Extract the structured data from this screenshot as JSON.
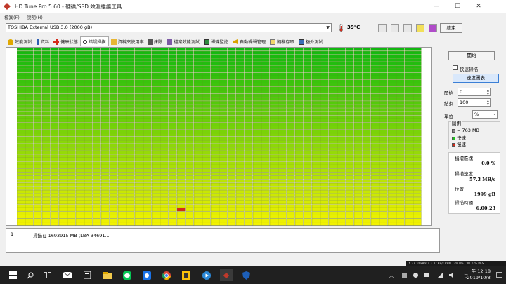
{
  "window": {
    "title": "HD Tune Pro 5.60 - 硬碟/SSD 效測維護工具",
    "controls": {
      "minimize": "—",
      "maximize": "☐",
      "close": "✕"
    }
  },
  "menu": [
    "檔案(F)",
    "說明(H)"
  ],
  "device": {
    "selected": "TOSHIBA External USB 3.0 (2000 gB)",
    "temperature": "39℃",
    "exit_label": "結束"
  },
  "tabs": [
    {
      "label": "效能測試",
      "icon": "benchmark-icon"
    },
    {
      "label": "資料",
      "icon": "info-icon"
    },
    {
      "label": "健康狀態",
      "icon": "health-icon"
    },
    {
      "label": "錯誤掃描",
      "icon": "error-scan-icon",
      "active": true
    },
    {
      "label": "資料夾使用率",
      "icon": "folder-usage-icon"
    },
    {
      "label": "抹除",
      "icon": "erase-icon"
    },
    {
      "label": "檔案效能測試",
      "icon": "file-benchmark-icon"
    },
    {
      "label": "磁碟監控",
      "icon": "disk-monitor-icon"
    },
    {
      "label": "自動噪聲管理",
      "icon": "aam-icon"
    },
    {
      "label": "隨機存取",
      "icon": "random-access-icon"
    },
    {
      "label": "額外測試",
      "icon": "extra-tests-icon"
    }
  ],
  "error_scan": {
    "start_button": "開始",
    "quick_scan_label": "快速掃描",
    "quick_scan_checked": false,
    "speed_map_button": "速度圖表",
    "start_label": "開始",
    "start_value": "0",
    "end_label": "結束",
    "end_value": "100",
    "unit_label": "單位",
    "unit_value": "%",
    "legend_title": "圖例",
    "legend": [
      {
        "label": "= 763 MB",
        "color": "#8a8a8a"
      },
      {
        "label": "快速",
        "color": "#1fbf1f"
      },
      {
        "label": "慢速",
        "color": "#d42a1a"
      }
    ],
    "stats": {
      "damaged_label": "損壞區塊",
      "damaged_value": "0.0 %",
      "speed_label": "掃描速度",
      "speed_value": "57.3 MB/s",
      "position_label": "位置",
      "position_value": "1999 gB",
      "elapsed_label": "掃描時間",
      "elapsed_value": "6:00:23"
    },
    "grid": {
      "cols": 48,
      "rows": 50,
      "highlight_colors": {
        "top": "#00b400",
        "bottom": "#f2f200",
        "slow": "#d42a1a"
      }
    }
  },
  "log": {
    "index": "1",
    "text": "掃描在 1693915 MB (LBA 34691..."
  },
  "statusbar": "↑ 27.10 kB/s  ↓ 2.37 KB/s  RAM 72%  0% CPU  37% RES",
  "taskbar": {
    "clock_time": "上午 12:18",
    "clock_date": "2019/10/8"
  }
}
